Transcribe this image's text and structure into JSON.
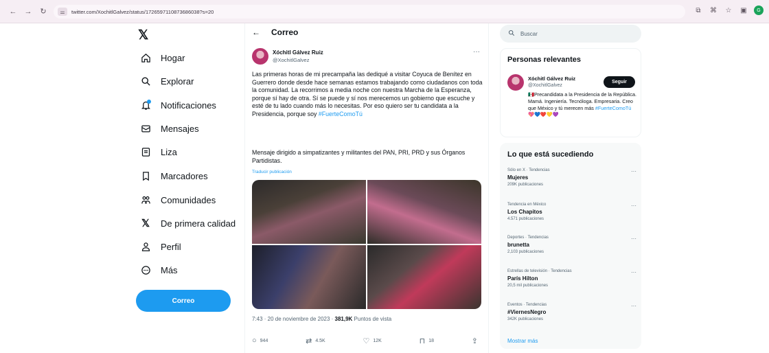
{
  "browser": {
    "url": "twitter.com/XochitlGalvez/status/1726597110873686038?s=20",
    "profile_initial": "G"
  },
  "nav": {
    "items": [
      {
        "label": "Hogar",
        "icon": "home-icon"
      },
      {
        "label": "Explorar",
        "icon": "search-icon"
      },
      {
        "label": "Notificaciones",
        "icon": "bell-icon"
      },
      {
        "label": "Mensajes",
        "icon": "mail-icon"
      },
      {
        "label": "Liza",
        "icon": "list-icon"
      },
      {
        "label": "Marcadores",
        "icon": "bookmark-icon"
      },
      {
        "label": "Comunidades",
        "icon": "people-icon"
      },
      {
        "label": "De primera calidad",
        "icon": "x-logo-icon"
      },
      {
        "label": "Perfil",
        "icon": "person-icon"
      },
      {
        "label": "Más",
        "icon": "more-circle-icon"
      }
    ],
    "post_button": "Correo"
  },
  "header": {
    "title": "Correo"
  },
  "tweet": {
    "author_name": "Xóchitl Gálvez Ruiz",
    "author_handle": "@XochitlGalvez",
    "text": "Las primeras horas de mi precampaña las dediqué a visitar Coyuca de Benítez en Guerrero donde desde hace semanas estamos trabajando como ciudadanos con toda la comunidad. La recorrimos a media noche con nuestra Marcha de la Esperanza, porque sí hay de otra. Sí se puede y sí nos merecemos un gobierno que escuche y esté de tu lado cuando más lo necesitas. Por eso quiero ser tu candidata a la Presidencia, porque soy ",
    "hashtag": "#FuerteComoTú",
    "text2": "Mensaje dirigido a simpatizantes y militantes del PAN, PRI, PRD y sus Órganos Partidistas.",
    "translate": "Traducir publicación",
    "time": "7:43 · 20 de noviembre de 2023 · ",
    "views": "381,9K",
    "views_label": " Puntos de vista",
    "replies": "944",
    "reposts": "4.5K",
    "likes": "12K",
    "bookmarks": "18"
  },
  "search": {
    "placeholder": "Buscar"
  },
  "relevant": {
    "title": "Personas relevantes",
    "name": "Xóchitl Gálvez Ruiz",
    "handle": "@XochitlGalvez",
    "follow": "Seguir",
    "bio": "🇲🇽Precandidata a la Presidencia de la República. Mamá. Ingeniería. Tecnóloga. Empresaria. Creo que México y tú merecen más ",
    "bio_tag": "#FuerteComoTú",
    "hearts": "💖💙❤️💛💜"
  },
  "trends": {
    "title": "Lo que está sucediendo",
    "items": [
      {
        "context": "Sólo en X · Tendencias",
        "name": "Mujeres",
        "count": "209K publicaciones"
      },
      {
        "context": "Tendencia en México",
        "name": "Los Chapitos",
        "count": "4.571 publicaciones"
      },
      {
        "context": "Deportes · Tendencias",
        "name": "brunetta",
        "count": "2,103 publicaciones"
      },
      {
        "context": "Estrellas de televisión · Tendencias",
        "name": "París Hilton",
        "count": "20,5 mil publicaciones"
      },
      {
        "context": "Eventos · Tendencias",
        "name": "#ViernesNegro",
        "count": "342K publicaciones"
      }
    ],
    "show_more": "Mostrar más"
  },
  "colors": {
    "accent": "#1d9bf0",
    "text": "#0f1419",
    "muted": "#536471",
    "chrome": "#f6eef4"
  }
}
